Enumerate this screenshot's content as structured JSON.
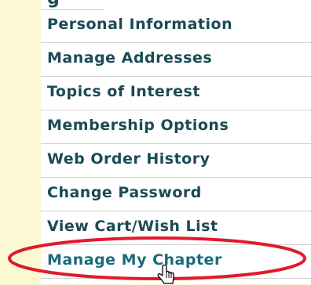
{
  "menu": {
    "items": [
      {
        "label": "Personal Information"
      },
      {
        "label": "Manage Addresses"
      },
      {
        "label": "Topics of Interest"
      },
      {
        "label": "Membership Options"
      },
      {
        "label": "Web Order History"
      },
      {
        "label": "Change Password"
      },
      {
        "label": "View Cart/Wish List"
      },
      {
        "label": "Manage My Chapter"
      }
    ]
  },
  "colors": {
    "background": "#fdf8d4",
    "link": "#1b4a55",
    "highlight": "#e01b2a"
  },
  "icons": {
    "cursor": "hand-pointer-icon"
  }
}
